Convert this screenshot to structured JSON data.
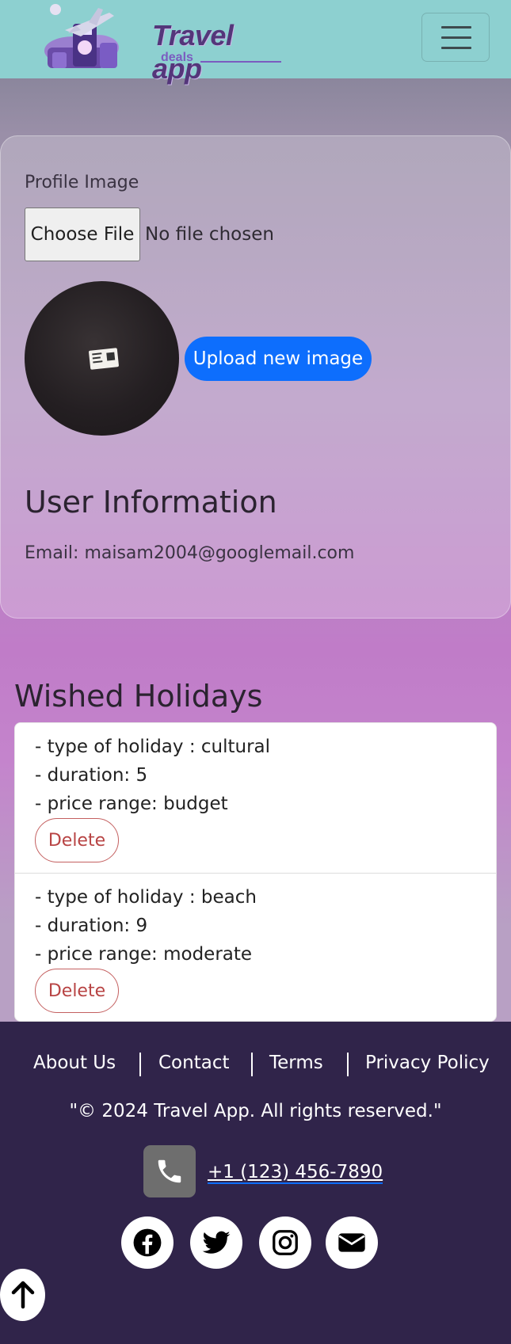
{
  "header": {
    "logo_title": "Travel app",
    "logo_subtitle": "deals",
    "menu_icon": "hamburger-icon"
  },
  "profile": {
    "image_label": "Profile Image",
    "choose_file_label": "Choose File",
    "no_file_text": "No file chosen",
    "upload_button_label": "Upload new image"
  },
  "user_info": {
    "title": "User Information",
    "email_line": "Email: maisam2004@googlemail.com"
  },
  "wished": {
    "title": "Wished Holidays",
    "items": [
      {
        "type_line": "- type of holiday : cultural",
        "duration_line": "- duration: 5",
        "price_line": "- price range: budget",
        "delete_label": "Delete"
      },
      {
        "type_line": "- type of holiday : beach",
        "duration_line": "- duration: 9",
        "price_line": "- price range: moderate",
        "delete_label": "Delete"
      }
    ]
  },
  "footer": {
    "links": [
      "About Us",
      "Contact",
      "Terms",
      "Privacy Policy"
    ],
    "copyright": "\"© 2024 Travel App. All rights reserved.\"",
    "phone": "+1 (123) 456-7890",
    "icons": {
      "phone": "phone-icon",
      "facebook": "facebook-icon",
      "twitter": "twitter-icon",
      "instagram": "instagram-icon",
      "email": "envelope-icon",
      "back_to_top": "arrow-up-icon"
    }
  },
  "colors": {
    "header_bg": "#8dd0d0",
    "primary": "#0d6efd",
    "danger": "#b84444",
    "footer_bg": "#30244a"
  }
}
